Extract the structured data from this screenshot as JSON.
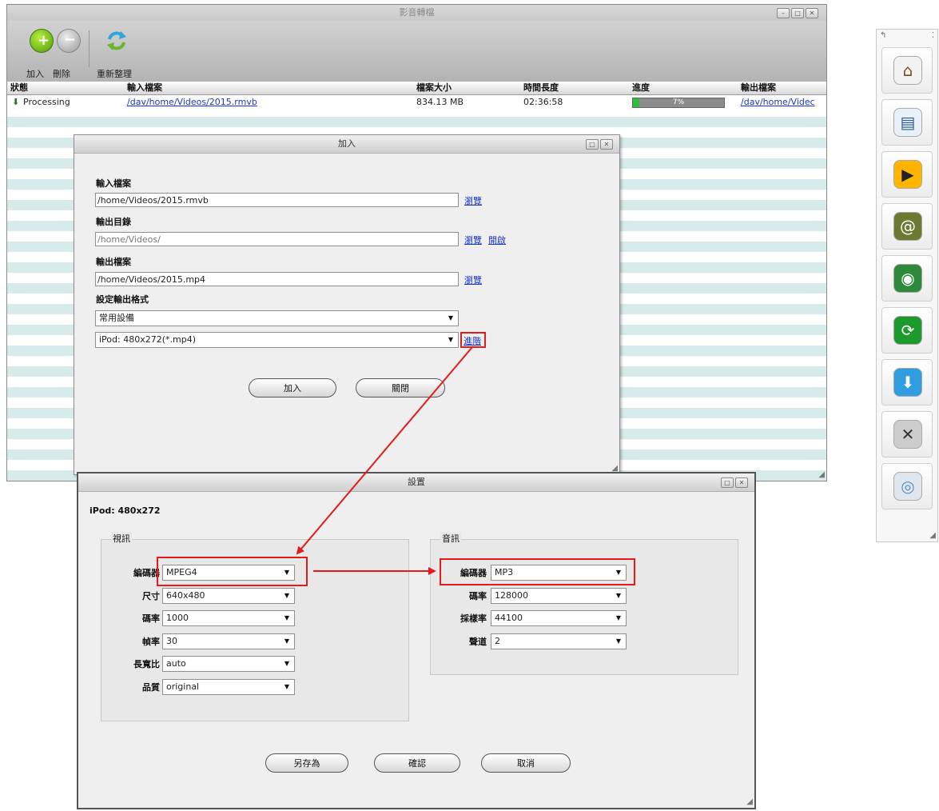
{
  "main_window": {
    "title": "影音轉檔",
    "toolbar": {
      "add_label": "加入",
      "delete_label": "刪除",
      "refresh_label": "重新整理"
    },
    "columns": [
      "狀態",
      "輸入檔案",
      "檔案大小",
      "時間長度",
      "進度",
      "輸出檔案"
    ],
    "row": {
      "status": "Processing",
      "input": "/dav/home/Videos/2015.rmvb",
      "size": "834.13 MB",
      "duration": "02:36:58",
      "progress_text": "7%",
      "progress": 0.07,
      "output": "/dav/home/Videc"
    }
  },
  "add_dialog": {
    "title": "加入",
    "input_file_label": "輸入檔案",
    "input_file_value": "/home/Videos/2015.rmvb",
    "browse_label": "瀏覽",
    "output_dir_label": "輸出目錄",
    "output_dir_value": "/home/Videos/",
    "open_label": "開啟",
    "output_file_label": "輸出檔案",
    "output_file_value": "/home/Videos/2015.mp4",
    "format_label": "設定輸出格式",
    "device_select": "常用設備",
    "preset_select": "iPod: 480x272(*.mp4)",
    "settings_link": "進階",
    "add_button": "加入",
    "close_button": "關閉"
  },
  "settings_dialog": {
    "title": "設置",
    "preset_name": "iPod: 480x272",
    "video": {
      "group_label": "視訊",
      "fields": [
        {
          "label": "編碼器",
          "value": "MPEG4"
        },
        {
          "label": "尺寸",
          "value": "640x480"
        },
        {
          "label": "碼率",
          "value": "1000"
        },
        {
          "label": "幀率",
          "value": "30"
        },
        {
          "label": "長寬比",
          "value": "auto"
        },
        {
          "label": "品質",
          "value": "original"
        }
      ]
    },
    "audio": {
      "group_label": "音訊",
      "fields": [
        {
          "label": "編碼器",
          "value": "MP3"
        },
        {
          "label": "碼率",
          "value": "128000"
        },
        {
          "label": "採樣率",
          "value": "44100"
        },
        {
          "label": "聲道",
          "value": "2"
        }
      ]
    },
    "save_as_button": "另存為",
    "confirm_button": "確認",
    "cancel_button": "取消"
  },
  "dock": {
    "icons": [
      "home-icon",
      "file-manager-icon",
      "media-player-icon",
      "contacts-icon",
      "network-icon",
      "sync-icon",
      "download-icon",
      "tools-icon",
      "settings-icon"
    ]
  },
  "colors": {
    "annotation_red": "#e21b1b",
    "link_blue": "#1a36c9",
    "stripe": "#d6ebea",
    "progress_green": "#2fbf3f"
  }
}
